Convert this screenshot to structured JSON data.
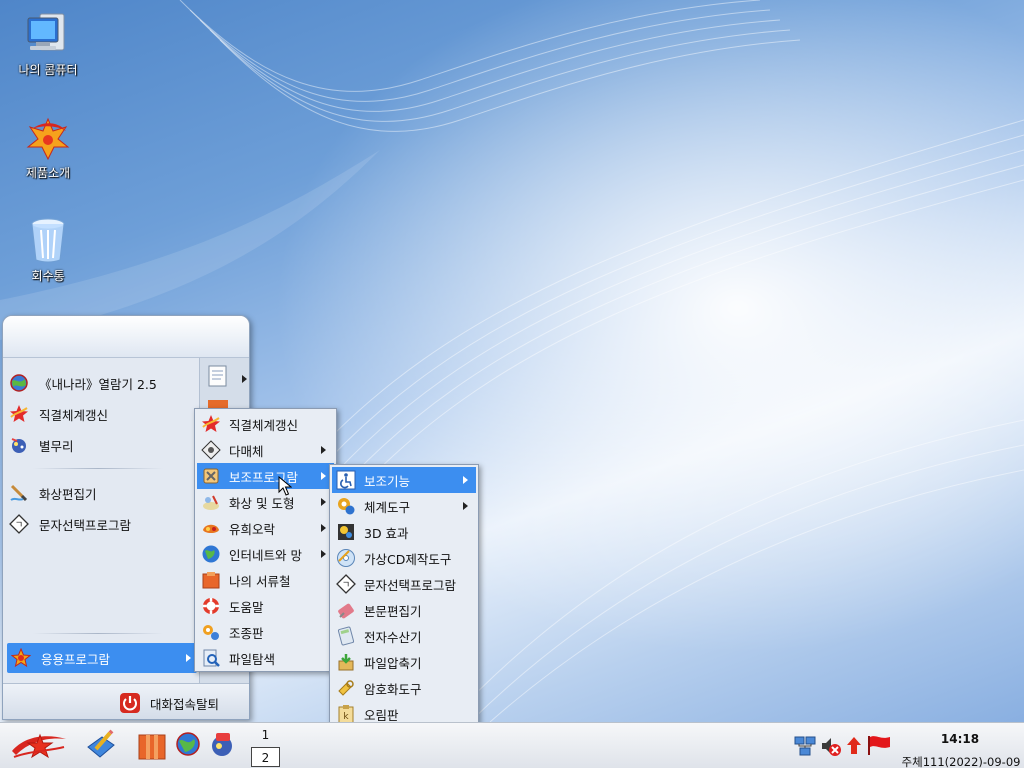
{
  "desktop": {
    "icons": [
      {
        "label": "나의 콤퓨터",
        "icon": "computer-icon"
      },
      {
        "label": "제품소개",
        "icon": "product-intro-icon"
      },
      {
        "label": "회수통",
        "icon": "recycle-bin-icon"
      }
    ]
  },
  "start_menu": {
    "items": [
      {
        "label": "《내나라》열람기 2.5",
        "icon": "globe-browser-icon"
      },
      {
        "label": "직결체계갱신",
        "icon": "star-update-icon"
      },
      {
        "label": "별무리",
        "icon": "star-cluster-icon"
      },
      {
        "label": "화상편집기",
        "icon": "image-editor-icon"
      },
      {
        "label": "문자선택프로그람",
        "icon": "char-select-icon"
      }
    ],
    "apps_label": "응용프로그람",
    "logout_label": "대화접속탈퇴"
  },
  "apps_menu": {
    "items": [
      {
        "label": "직결체계갱신",
        "icon": "star-update-icon",
        "submenu": false
      },
      {
        "label": "다매체",
        "icon": "multimedia-icon",
        "submenu": true
      },
      {
        "label": "보조프로그람",
        "icon": "accessories-icon",
        "submenu": true,
        "active": true
      },
      {
        "label": "화상 및 도형",
        "icon": "graphics-icon",
        "submenu": true
      },
      {
        "label": "유희오락",
        "icon": "games-icon",
        "submenu": true
      },
      {
        "label": "인터네트와 망",
        "icon": "internet-icon",
        "submenu": true
      },
      {
        "label": "나의 서류철",
        "icon": "documents-icon",
        "submenu": false
      },
      {
        "label": "도움말",
        "icon": "help-icon",
        "submenu": false
      },
      {
        "label": "조종판",
        "icon": "control-panel-icon",
        "submenu": false
      },
      {
        "label": "파일탐색",
        "icon": "file-search-icon",
        "submenu": false
      }
    ]
  },
  "accessories_menu": {
    "items": [
      {
        "label": "보조기능",
        "icon": "accessibility-icon",
        "submenu": true,
        "active": true
      },
      {
        "label": "체계도구",
        "icon": "system-tools-icon",
        "submenu": true
      },
      {
        "label": "3D 효과",
        "icon": "3d-effect-icon",
        "submenu": false
      },
      {
        "label": "가상CD제작도구",
        "icon": "virtual-cd-icon",
        "submenu": false
      },
      {
        "label": "문자선택프로그람",
        "icon": "char-select-icon",
        "submenu": false
      },
      {
        "label": "본문편집기",
        "icon": "text-editor-icon",
        "submenu": false
      },
      {
        "label": "전자수산기",
        "icon": "calculator-icon",
        "submenu": false
      },
      {
        "label": "파일압축기",
        "icon": "archiver-icon",
        "submenu": false
      },
      {
        "label": "암호화도구",
        "icon": "encryption-icon",
        "submenu": false
      },
      {
        "label": "오림판",
        "icon": "clipboard-icon",
        "submenu": false
      }
    ]
  },
  "taskbar": {
    "workspaces": [
      "1",
      "2"
    ],
    "clock_time": "14:18",
    "clock_date": "주체111(2022)-09-09"
  }
}
